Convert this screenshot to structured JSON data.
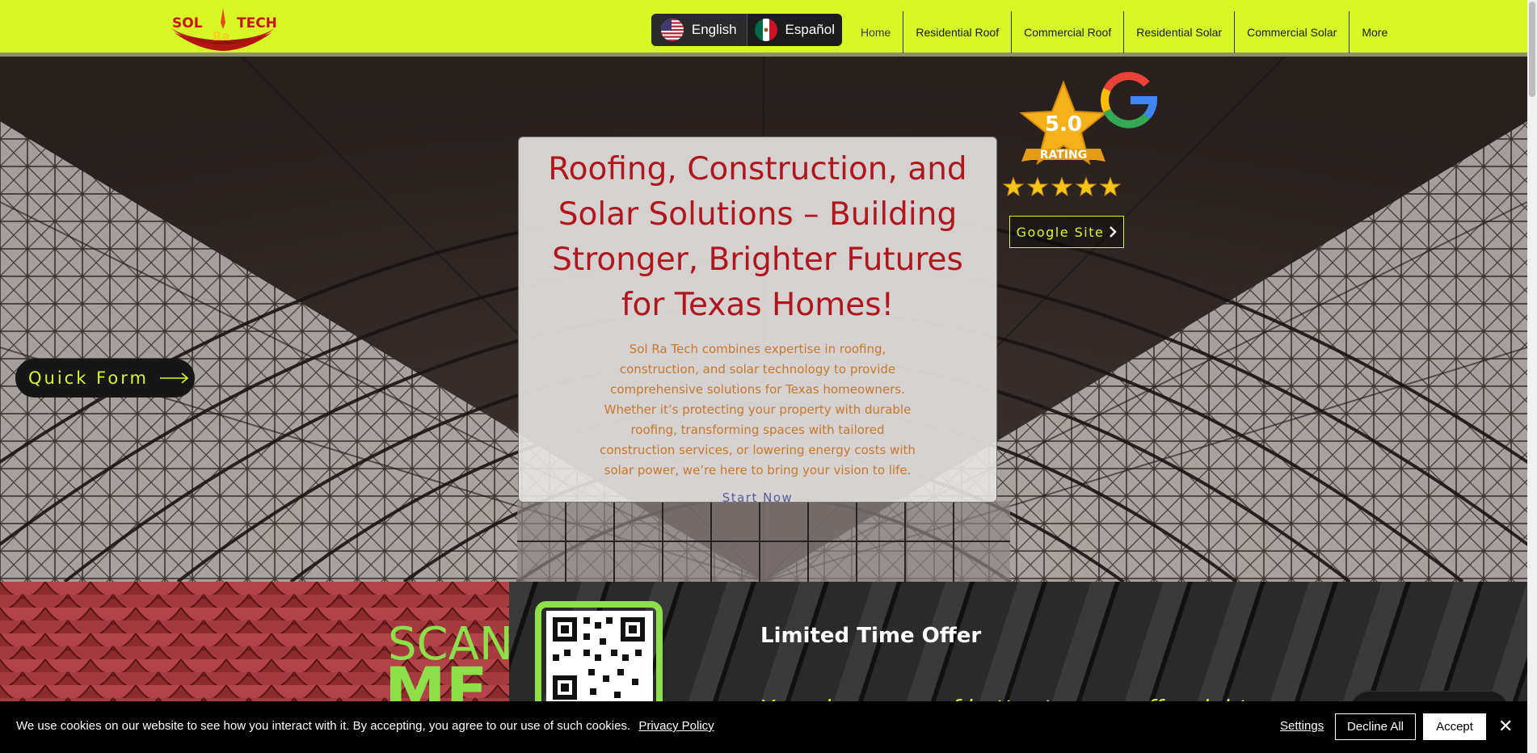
{
  "header": {
    "logo_alt": "Sol Ra Tech",
    "logo_text_left": "SOL",
    "logo_text_mid": "Ra",
    "logo_text_right": "TECH",
    "languages": [
      {
        "label": "English",
        "flag": "us-flag-icon",
        "active": true
      },
      {
        "label": "Español",
        "flag": "mx-flag-icon",
        "active": false
      }
    ],
    "nav": [
      {
        "label": "Home",
        "active": true
      },
      {
        "label": "Residential Roof"
      },
      {
        "label": "Commercial Roof"
      },
      {
        "label": "Residential Solar"
      },
      {
        "label": "Commercial Solar"
      },
      {
        "label": "More"
      }
    ]
  },
  "hero": {
    "title": "Roofing, Construction, and Solar Solutions – Building Stronger, Brighter Futures for Texas Homes!",
    "description": "Sol Ra Tech combines expertise in roofing, construction, and solar technology to provide comprehensive solutions for Texas homeowners. Whether it’s protecting your property with durable roofing, transforming spaces with tailored construction services, or lowering energy costs with solar power, we’re here to bring your vision to life.",
    "cta": "Start Now",
    "quick_form": "Quick Form",
    "rating": {
      "score": "5.0",
      "label": "RATING",
      "stars": 5,
      "google_button": "Google Site"
    }
  },
  "offer": {
    "scan_text_1": "SCAN",
    "scan_text_2": "ME",
    "title": "Limited Time Offer",
    "subtitle": "Your deserve roof better to save offer right"
  },
  "cookie": {
    "text": "We use cookies on our website to see how you interact with it. By accepting, you agree to our use of such cookies.",
    "policy_link": "Privacy Policy",
    "settings": "Settings",
    "decline": "Decline All",
    "accept": "Accept",
    "close": "✕"
  },
  "colors": {
    "brand_lime": "#d8f726",
    "title_red": "#b0171d",
    "desc_orange": "#c8782a"
  }
}
